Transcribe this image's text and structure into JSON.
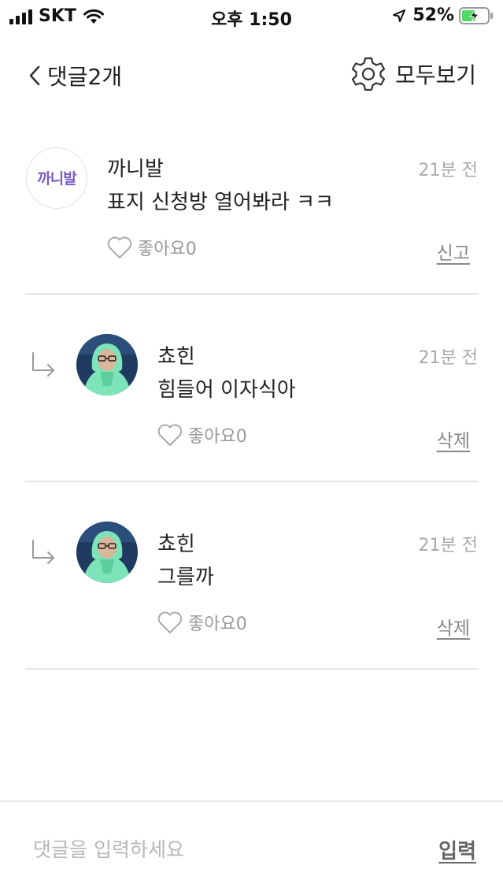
{
  "status_bar": {
    "carrier": "SKT",
    "time": "오후 1:50",
    "battery": "52%"
  },
  "header": {
    "title": "댓글2개",
    "view_all_label": "모두보기"
  },
  "comments": [
    {
      "author": "까니발",
      "avatar_text": "까니발",
      "time": "21분 전",
      "text": "표지 신청방 열어봐라 ㅋㅋ",
      "like_label": "좋아요0",
      "action": "신고",
      "is_reply": false
    },
    {
      "author": "쵸힌",
      "time": "21분 전",
      "text": "힘들어 이자식아",
      "like_label": "좋아요0",
      "action": "삭제",
      "is_reply": true
    },
    {
      "author": "쵸힌",
      "time": "21분 전",
      "text": "그를까",
      "like_label": "좋아요0",
      "action": "삭제",
      "is_reply": true
    }
  ],
  "input_bar": {
    "placeholder": "댓글을 입력하세요",
    "value": "",
    "submit_label": "입력"
  },
  "colors": {
    "text": "#222222",
    "muted": "#999999",
    "divider": "#e6e6e6",
    "battery": "#4cd964",
    "avatar_bg": "#1e3a5f",
    "avatar_hoodie": "#7de3b8"
  }
}
